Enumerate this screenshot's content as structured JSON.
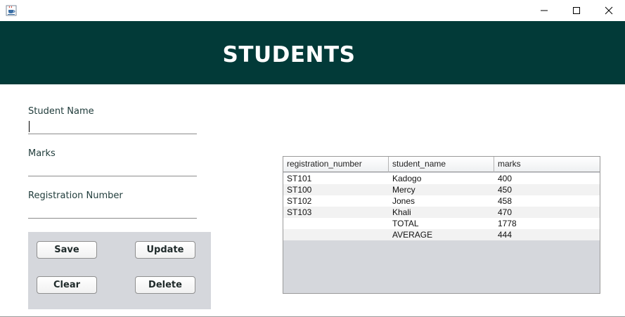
{
  "window": {
    "icon": "java-coffee-cup-icon",
    "controls": [
      "minimize-icon",
      "maximize-icon",
      "close-icon"
    ]
  },
  "header": {
    "title": "STUDENTS",
    "background": "#023a38"
  },
  "form": {
    "student_name_label": "Student Name",
    "student_name_value": "",
    "marks_label": "Marks",
    "marks_value": "",
    "registration_label": "Registration Number",
    "registration_value": ""
  },
  "buttons": {
    "save": "Save",
    "update": "Update",
    "clear": "Clear",
    "delete": "Delete"
  },
  "table": {
    "columns": [
      "registration_number",
      "student_name",
      "marks"
    ],
    "rows": [
      [
        "ST101",
        "Kadogo",
        "400"
      ],
      [
        "ST100",
        "Mercy",
        "450"
      ],
      [
        "ST102",
        "Jones",
        "458"
      ],
      [
        "ST103",
        "Khali",
        "470"
      ],
      [
        "",
        "TOTAL",
        "1778"
      ],
      [
        "",
        "AVERAGE",
        "444"
      ]
    ]
  }
}
